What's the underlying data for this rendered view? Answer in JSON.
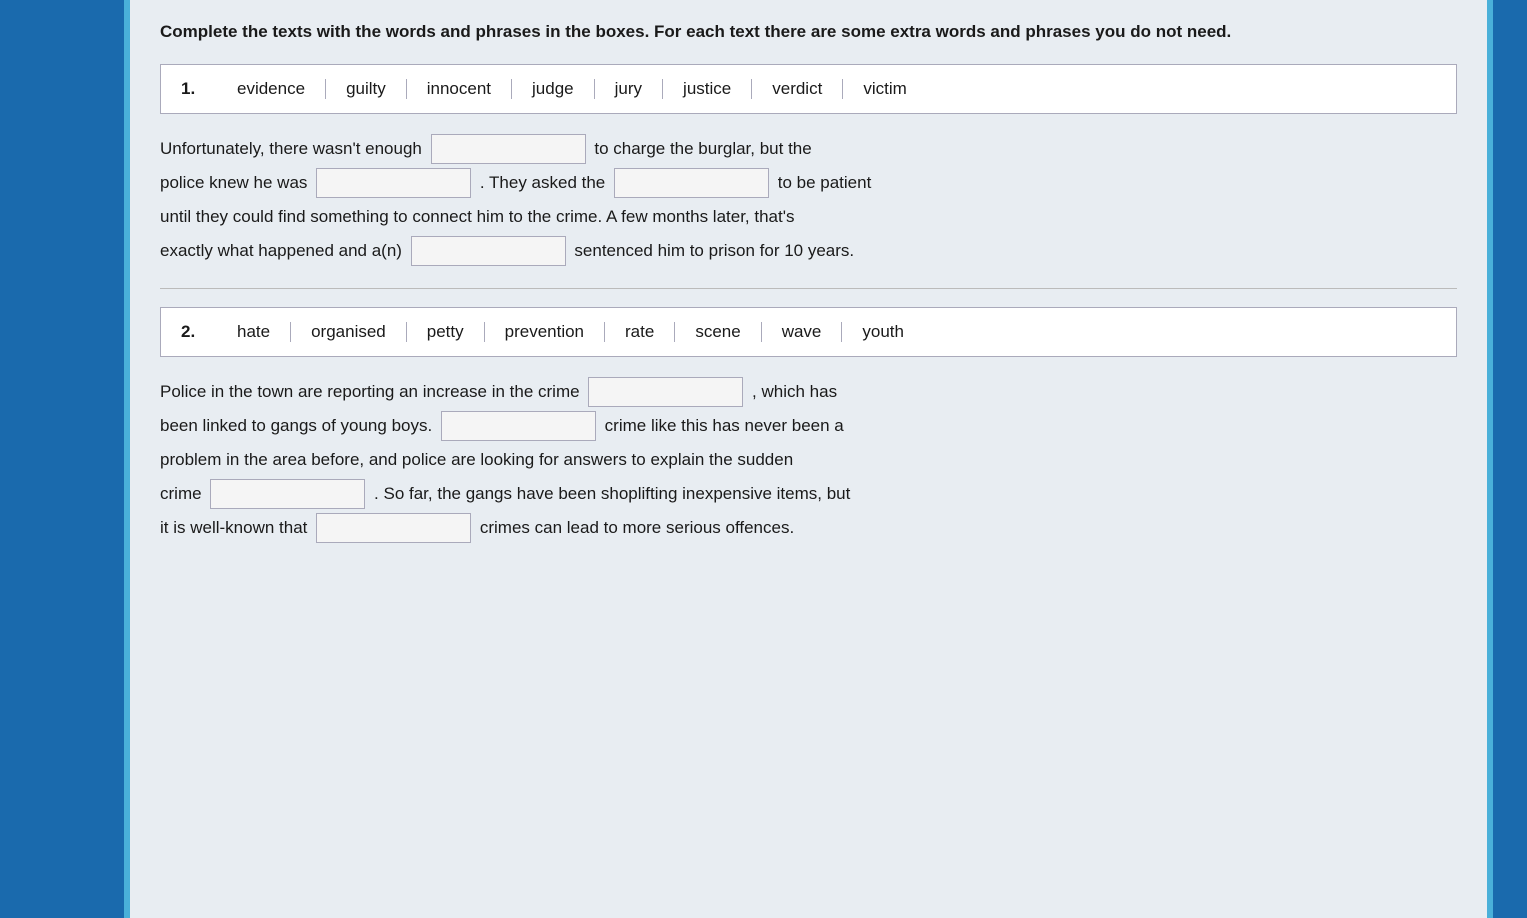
{
  "instructions": "Complete the texts with the words and phrases in the boxes. For each text there are some extra words and phrases you do not need.",
  "section1": {
    "number": "1.",
    "words": [
      "evidence",
      "guilty",
      "innocent",
      "judge",
      "jury",
      "justice",
      "verdict",
      "victim"
    ]
  },
  "section1_text": {
    "part1": "Unfortunately, there wasn't enough",
    "part2": "to charge the burglar, but the",
    "part3": "police knew he was",
    "part4": ". They asked the",
    "part5": "to be patient",
    "part6": "until they could find something to connect him to the crime. A few months later, that's",
    "part7": "exactly what happened and a(n)",
    "part8": "sentenced him to prison for 10 years."
  },
  "section2": {
    "number": "2.",
    "words": [
      "hate",
      "organised",
      "petty",
      "prevention",
      "rate",
      "scene",
      "wave",
      "youth"
    ]
  },
  "section2_text": {
    "part1": "Police in the town are reporting an increase in the crime",
    "part2": ", which has",
    "part3": "been linked to gangs of young boys.",
    "part4": "crime like this has never been a",
    "part5": "problem in the area before, and police are looking for answers to explain the sudden",
    "part6": "crime",
    "part7": ". So far, the gangs have been shoplifting inexpensive items, but",
    "part8": "it is well-known that",
    "part9": "crimes can lead to more serious offences."
  }
}
